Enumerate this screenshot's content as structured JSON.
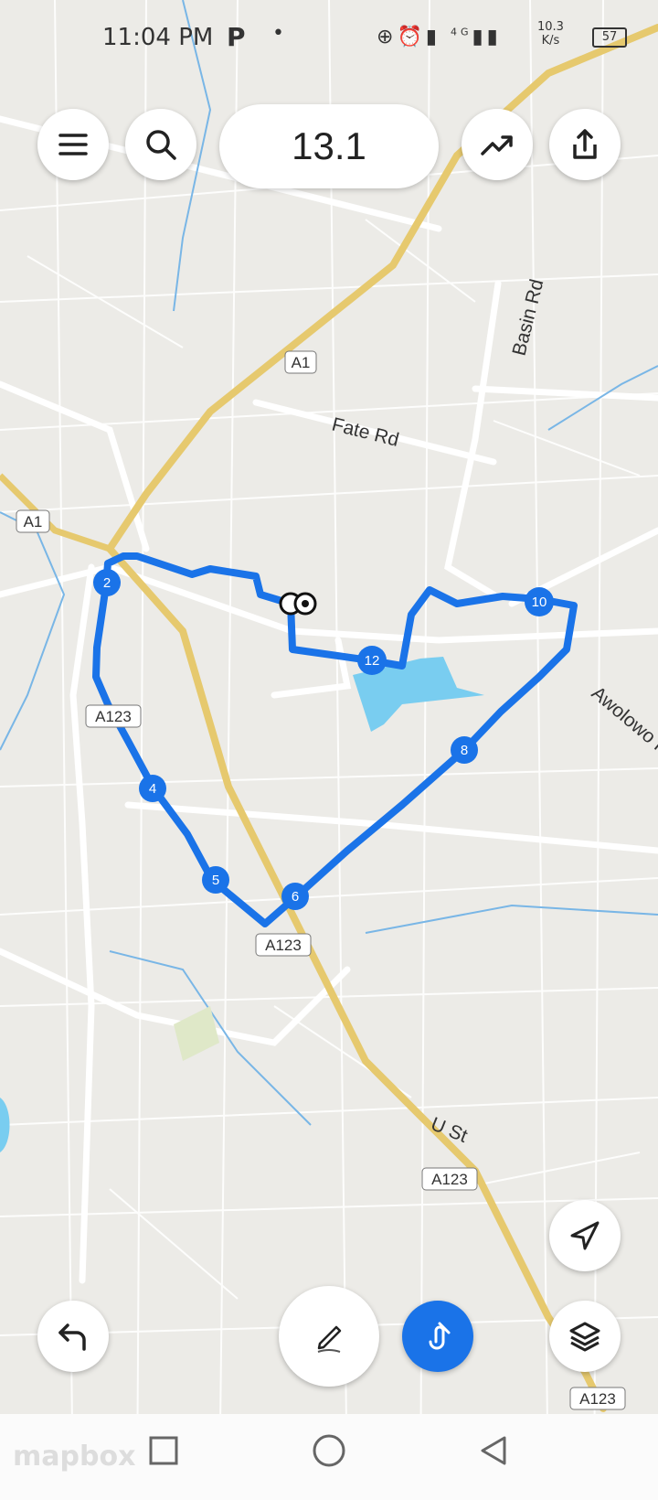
{
  "status_bar": {
    "time": "11:04 PM",
    "app_indicator": "P",
    "dot": "•",
    "network_speed_value": "10.3",
    "network_speed_unit": "K/s",
    "network_type": "4G",
    "battery": "57"
  },
  "toolbar": {
    "distance": "13.1",
    "menu_icon": "menu-icon",
    "search_icon": "search-icon",
    "elevation_icon": "trending-up-icon",
    "share_icon": "share-icon"
  },
  "map": {
    "road_labels": [
      "A1",
      "A1",
      "Fate Rd",
      "Basin Rd",
      "A123",
      "A123",
      "A123",
      "A123",
      "Awolowo Rd",
      "U St"
    ],
    "route_color": "#1a73e8",
    "waypoints": [
      "2",
      "4",
      "5",
      "6",
      "8",
      "10",
      "12"
    ],
    "attribution": "mapbox"
  },
  "controls": {
    "undo_icon": "undo-icon",
    "draw_icon": "pencil-icon",
    "snap_icon": "snap-to-road-icon",
    "locate_icon": "navigation-arrow-icon",
    "layers_icon": "layers-icon"
  },
  "navbar": {
    "recent_icon": "square-icon",
    "home_icon": "circle-icon",
    "back_icon": "triangle-back-icon"
  }
}
